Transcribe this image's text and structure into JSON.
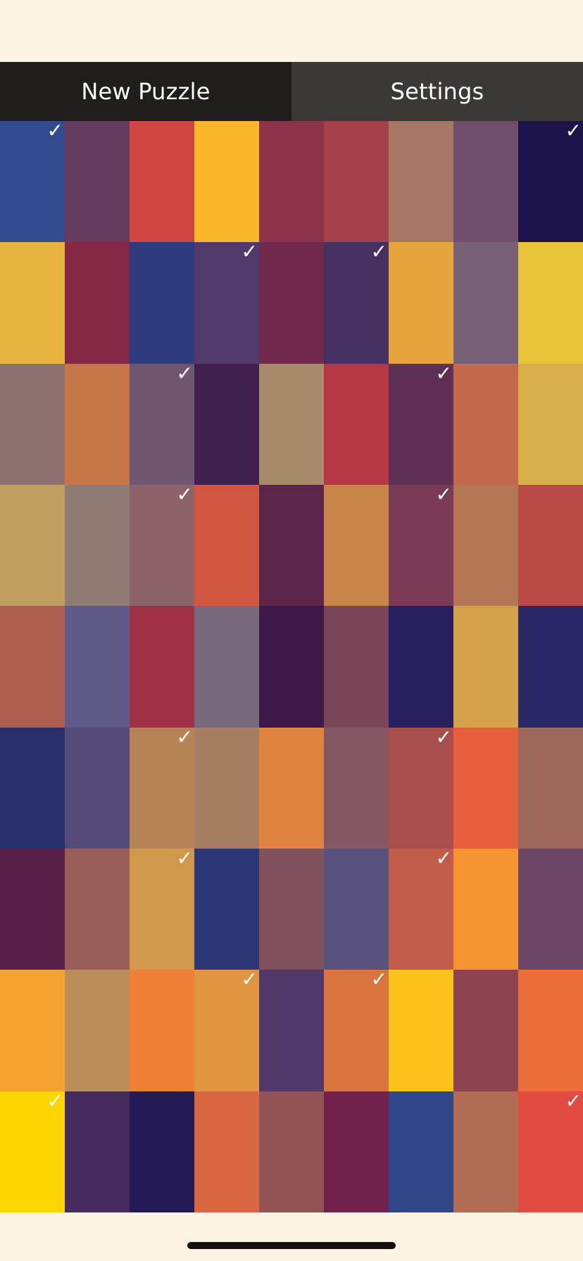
{
  "toolbar": {
    "new_puzzle_label": "New Puzzle",
    "settings_label": "Settings"
  },
  "check_glyph": "✓",
  "grid": {
    "columns": 9,
    "rows": 9,
    "tiles": [
      {
        "color": "#334b8f",
        "locked": true
      },
      {
        "color": "#643a5e",
        "locked": false
      },
      {
        "color": "#d04442",
        "locked": false
      },
      {
        "color": "#fbb629",
        "locked": false
      },
      {
        "color": "#8a334b",
        "locked": false
      },
      {
        "color": "#a44149",
        "locked": false
      },
      {
        "color": "#a47663",
        "locked": false
      },
      {
        "color": "#6f4f6b",
        "locked": false
      },
      {
        "color": "#1d134b",
        "locked": true
      },
      {
        "color": "#e6b43f",
        "locked": false
      },
      {
        "color": "#842846",
        "locked": false
      },
      {
        "color": "#2e3b7e",
        "locked": false
      },
      {
        "color": "#523b6c",
        "locked": true
      },
      {
        "color": "#722a4c",
        "locked": false
      },
      {
        "color": "#463060",
        "locked": true
      },
      {
        "color": "#e6a43c",
        "locked": false
      },
      {
        "color": "#776177",
        "locked": false
      },
      {
        "color": "#e9c43a",
        "locked": false
      },
      {
        "color": "#8d716f",
        "locked": false
      },
      {
        "color": "#c77747",
        "locked": false
      },
      {
        "color": "#71566f",
        "locked": true
      },
      {
        "color": "#41204e",
        "locked": false
      },
      {
        "color": "#a68a6b",
        "locked": false
      },
      {
        "color": "#b63845",
        "locked": false
      },
      {
        "color": "#5f3055",
        "locked": true
      },
      {
        "color": "#c3684a",
        "locked": false
      },
      {
        "color": "#d6af4b",
        "locked": false
      },
      {
        "color": "#c09e5f",
        "locked": false
      },
      {
        "color": "#8f7a74",
        "locked": false
      },
      {
        "color": "#8c6368",
        "locked": true
      },
      {
        "color": "#d05641",
        "locked": false
      },
      {
        "color": "#5c264b",
        "locked": false
      },
      {
        "color": "#c8864b",
        "locked": false
      },
      {
        "color": "#7a3a55",
        "locked": true
      },
      {
        "color": "#b37754",
        "locked": false
      },
      {
        "color": "#ba4a48",
        "locked": false
      },
      {
        "color": "#ae5e50",
        "locked": false
      },
      {
        "color": "#5f5a88",
        "locked": false
      },
      {
        "color": "#9e3145",
        "locked": false
      },
      {
        "color": "#79697d",
        "locked": false
      },
      {
        "color": "#3e1848",
        "locked": false
      },
      {
        "color": "#7a4557",
        "locked": false
      },
      {
        "color": "#26215e",
        "locked": false
      },
      {
        "color": "#d3a24b",
        "locked": false
      },
      {
        "color": "#2a2866",
        "locked": false
      },
      {
        "color": "#2a306b",
        "locked": false
      },
      {
        "color": "#554a79",
        "locked": false
      },
      {
        "color": "#b78457",
        "locked": true
      },
      {
        "color": "#a57d63",
        "locked": false
      },
      {
        "color": "#df833f",
        "locked": false
      },
      {
        "color": "#835763",
        "locked": false
      },
      {
        "color": "#a84f4e",
        "locked": true
      },
      {
        "color": "#e75e3d",
        "locked": false
      },
      {
        "color": "#9d695d",
        "locked": false
      },
      {
        "color": "#581f48",
        "locked": false
      },
      {
        "color": "#9a5e58",
        "locked": false
      },
      {
        "color": "#d0984b",
        "locked": true
      },
      {
        "color": "#2d3677",
        "locked": false
      },
      {
        "color": "#81525d",
        "locked": false
      },
      {
        "color": "#5a527e",
        "locked": false
      },
      {
        "color": "#c25c4a",
        "locked": true
      },
      {
        "color": "#f49433",
        "locked": false
      },
      {
        "color": "#6a4566",
        "locked": false
      },
      {
        "color": "#f5a22f",
        "locked": false
      },
      {
        "color": "#bb8d58",
        "locked": false
      },
      {
        "color": "#ef7f36",
        "locked": false
      },
      {
        "color": "#e19540",
        "locked": true
      },
      {
        "color": "#503868",
        "locked": false
      },
      {
        "color": "#d9743f",
        "locked": true
      },
      {
        "color": "#fbc21c",
        "locked": false
      },
      {
        "color": "#8e4450",
        "locked": false
      },
      {
        "color": "#ec6c3a",
        "locked": false
      },
      {
        "color": "#fdd500",
        "locked": true
      },
      {
        "color": "#472a5d",
        "locked": false
      },
      {
        "color": "#231a55",
        "locked": false
      },
      {
        "color": "#d86641",
        "locked": false
      },
      {
        "color": "#935256",
        "locked": false
      },
      {
        "color": "#71224c",
        "locked": false
      },
      {
        "color": "#2f4689",
        "locked": false
      },
      {
        "color": "#b06c52",
        "locked": false
      },
      {
        "color": "#e24b41",
        "locked": true
      }
    ]
  }
}
